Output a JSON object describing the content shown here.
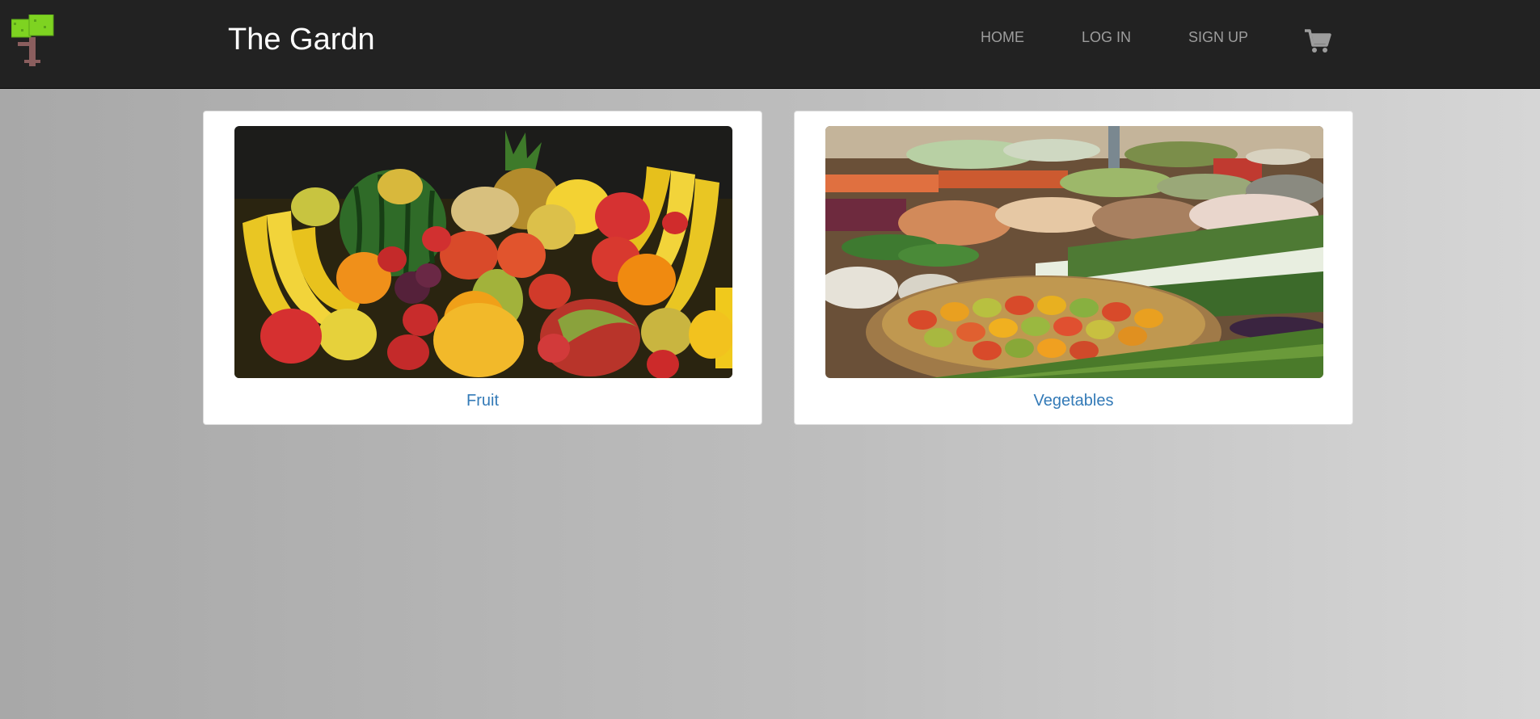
{
  "header": {
    "brand": "The Gardn",
    "logo_icon": "tree-icon",
    "nav": [
      {
        "label": "HOME"
      },
      {
        "label": "LOG IN"
      },
      {
        "label": "SIGN UP"
      }
    ],
    "cart_icon": "shopping-cart-icon"
  },
  "categories": [
    {
      "label": "Fruit",
      "image": "fruit-assortment-photo"
    },
    {
      "label": "Vegetables",
      "image": "vegetable-market-photo"
    }
  ],
  "colors": {
    "navbar": "#222222",
    "nav_link": "#9d9d9d",
    "brand": "#ffffff",
    "link": "#337ab7",
    "tree_leaf": "#7ed321",
    "tree_trunk": "#8b5e5e"
  }
}
